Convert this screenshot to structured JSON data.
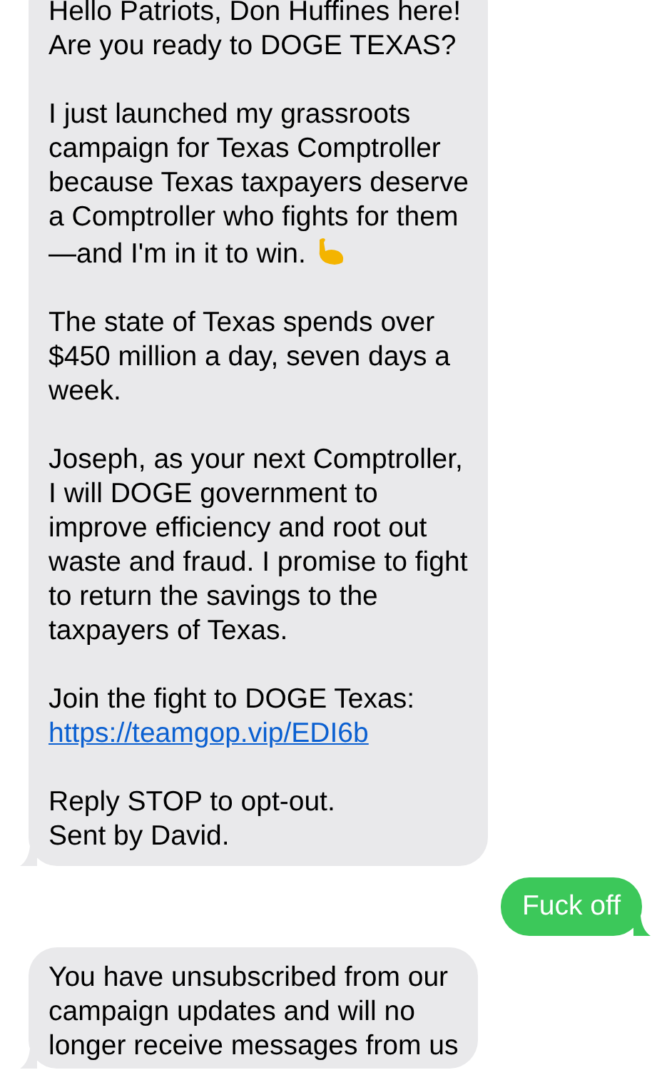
{
  "messages": [
    {
      "kind": "received",
      "paragraphs": [
        {
          "text": "Hello Patriots, Don Huffines here!\nAre you ready to DOGE TEXAS?"
        },
        {
          "text": "I just launched my grassroots\ncampaign for Texas Comptroller\nbecause Texas taxpayers deserve\na Comptroller who fights for them\n—and I'm in it to win.",
          "kind": "with-emoji"
        },
        {
          "text": "The state of Texas spends over\n$450 million a day, seven days a\nweek."
        },
        {
          "text": "Joseph, as your next Comptroller,\nI will DOGE government to\nimprove efficiency and root out\nwaste and fraud. I promise to fight\nto return the savings to the\ntaxpayers of Texas."
        },
        {
          "text": "Join the fight to DOGE Texas:",
          "link": "https://teamgop.vip/EDI6b"
        },
        {
          "text": "Reply STOP to opt-out.\nSent by David."
        }
      ]
    },
    {
      "kind": "sent",
      "paragraphs": [
        {
          "text": "Fuck off"
        }
      ]
    },
    {
      "kind": "received",
      "paragraphs": [
        {
          "text": "You have unsubscribed from our\ncampaign updates and will no\nlonger receive messages from us"
        }
      ]
    }
  ]
}
